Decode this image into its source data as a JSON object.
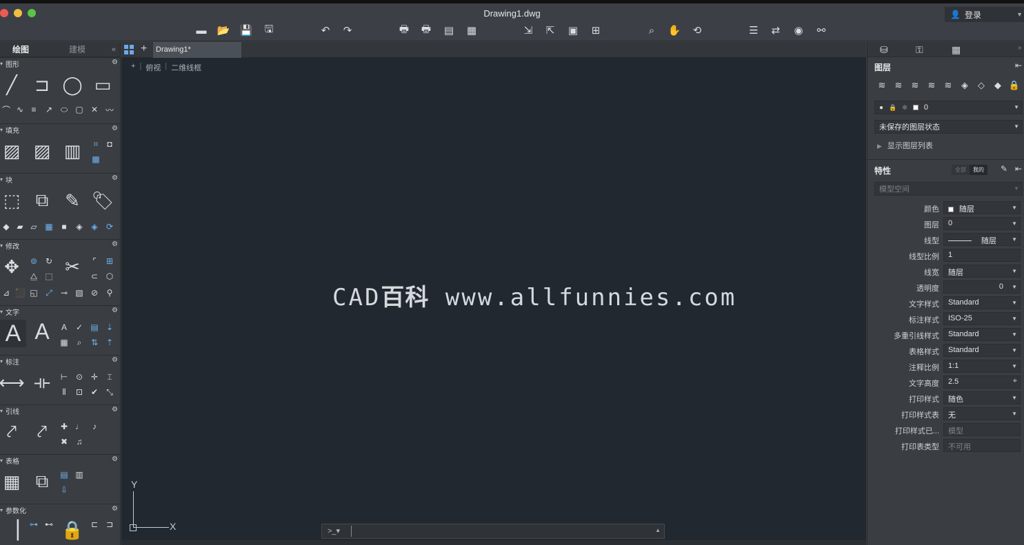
{
  "window": {
    "title": "Drawing1.dwg",
    "login_label": "登录"
  },
  "toolbar": {
    "icons": [
      "new-file-icon",
      "open-file-icon",
      "save-icon",
      "save-as-icon",
      "undo-icon",
      "redo-icon",
      "plot-icon",
      "batch-plot-icon",
      "page-setup-icon",
      "publish-icon",
      "import-icon",
      "export-icon",
      "attach-icon",
      "xref-icon",
      "zoom-icon",
      "pan-icon",
      "orbit-icon",
      "properties-icon",
      "match-icon",
      "render-icon",
      "network-icon"
    ]
  },
  "left_panel": {
    "tabs": [
      "绘图",
      "建模"
    ],
    "collapse": "«",
    "sections": [
      "图形",
      "填充",
      "块",
      "修改",
      "文字",
      "标注",
      "引线",
      "表格",
      "参数化"
    ]
  },
  "doc_tabs": {
    "active": "Drawing1*"
  },
  "canvas": {
    "view_controls": [
      "+",
      "俯视",
      "二维线框"
    ],
    "watermark_latin": "CAD",
    "watermark_cjk": "百科",
    "watermark_url": "www.allfunnies.com",
    "ucs_y": "Y",
    "ucs_x": "X"
  },
  "command_line": {
    "prompt": ">_▾",
    "value": ""
  },
  "right_panel": {
    "layers": {
      "heading": "图层",
      "current_layer": "0",
      "layer_state": "未保存的图层状态",
      "show_list": "显示图层列表"
    },
    "properties": {
      "heading": "特性",
      "seg_all": "全部",
      "seg_mine": "我的",
      "space": "模型空间",
      "rows": [
        {
          "label": "颜色",
          "value": "随层"
        },
        {
          "label": "图层",
          "value": "0"
        },
        {
          "label": "线型",
          "value": "随层"
        },
        {
          "label": "线型比例",
          "value": "1"
        },
        {
          "label": "线宽",
          "value": "随层"
        },
        {
          "label": "透明度",
          "value": "0"
        },
        {
          "label": "文字样式",
          "value": "Standard"
        },
        {
          "label": "标注样式",
          "value": "ISO-25"
        },
        {
          "label": "多重引线样式",
          "value": "Standard"
        },
        {
          "label": "表格样式",
          "value": "Standard"
        },
        {
          "label": "注释比例",
          "value": "1:1"
        },
        {
          "label": "文字高度",
          "value": "2.5"
        },
        {
          "label": "打印样式",
          "value": "随色"
        },
        {
          "label": "打印样式表",
          "value": "无"
        },
        {
          "label": "打印样式已...",
          "value": "模型"
        },
        {
          "label": "打印表类型",
          "value": "不可用"
        }
      ]
    }
  },
  "colors": {
    "canvas_bg": "#212830",
    "panel_bg": "#3a3e43",
    "accent_blue": "#6fb2f0"
  }
}
